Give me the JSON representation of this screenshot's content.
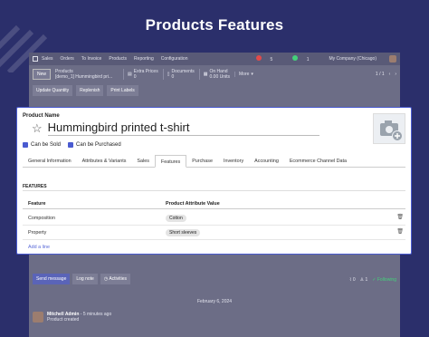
{
  "hero_title": "Products Features",
  "topnav": {
    "app": "Sales",
    "menus": [
      "Orders",
      "To Invoice",
      "Products",
      "Reporting",
      "Configuration"
    ],
    "company": "My Company (Chicago)",
    "badge1": "5",
    "badge2": "1"
  },
  "control": {
    "new_label": "New",
    "crumb_parent": "Products",
    "crumb_current": "[demo_1] Hummingbird pri...",
    "stat_extra_prices": "Extra Prices",
    "stat_extra_prices_value": "0",
    "stat_documents_label": "Documents",
    "stat_documents_value": "0",
    "stat_onhand_label": "On Hand",
    "stat_onhand_value": "0.00 Units",
    "more_label": "More",
    "pager": "1 / 1"
  },
  "actions": [
    "Update Quantity",
    "Replenish",
    "Print Labels"
  ],
  "form": {
    "name_label": "Product Name",
    "name_value": "Hummingbird printed t-shirt",
    "can_be_sold": "Can be Sold",
    "can_be_purchased": "Can be Purchased",
    "tabs": [
      "General Information",
      "Attributes & Variants",
      "Sales",
      "Features",
      "Purchase",
      "Inventory",
      "Accounting",
      "Ecommerce Channel Data"
    ],
    "active_tab": "Features",
    "section_title": "FEATURES",
    "col_feature": "Feature",
    "col_value": "Product Attribute Value",
    "rows": [
      {
        "feature": "Composition",
        "value": "Cotton"
      },
      {
        "feature": "Property",
        "value": "Short sleeves"
      }
    ],
    "add_line": "Add a line"
  },
  "chatter": {
    "send_message": "Send message",
    "log_note": "Log note",
    "activities": "Activities",
    "attachments": "0",
    "followers": "1",
    "following": "Following",
    "date_separator": "February 6, 2024",
    "author": "Mitchell Admin",
    "time": "- 5 minutes ago",
    "message": "Product created"
  },
  "colors": {
    "background": "#2b2f6b",
    "accent": "#4a5bd0",
    "following": "#44d17a"
  }
}
